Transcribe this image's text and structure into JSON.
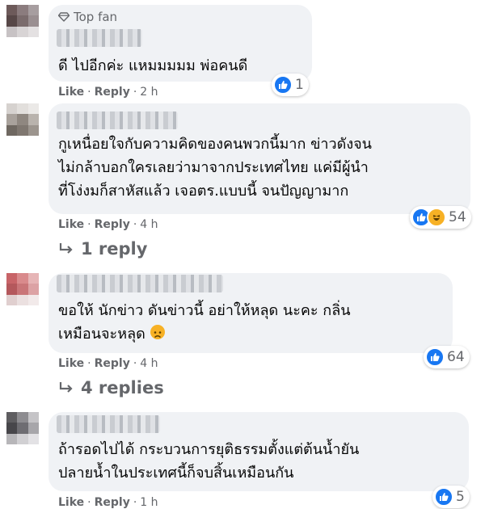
{
  "comments": [
    {
      "badge": "Top fan",
      "text_lines": [
        "ดี ไปอีกค่ะ แหมมมมม พ่อคนดี"
      ],
      "reactions": {
        "types": [
          "like"
        ],
        "count": "1"
      },
      "actions": {
        "like": "Like",
        "reply": "Reply",
        "time": "2 h"
      }
    },
    {
      "text_lines": [
        "กูเหนื่อยใจกับความคิดของคนพวกนี้มาก ข่าวดังจน",
        "ไม่กล้าบอกใครเลยว่ามาจากประเทศไทย แค่มีผู้นำ",
        "ที่โง่งมก็สาหัสแล้ว เจอตร.แบบนี้ จนปัญญามาก"
      ],
      "reactions": {
        "types": [
          "like",
          "haha"
        ],
        "count": "54"
      },
      "actions": {
        "like": "Like",
        "reply": "Reply",
        "time": "4 h"
      },
      "replies_label": "1 reply"
    },
    {
      "text_lines": [
        "ขอให้ นักข่าว ดันข่าวนี้ อย่าให้หลุด นะคะ กลิ่น",
        "เหมือนจะหลุด"
      ],
      "reactions": {
        "types": [
          "like"
        ],
        "count": "64"
      },
      "actions": {
        "like": "Like",
        "reply": "Reply",
        "time": "4 h"
      },
      "replies_label": "4 replies"
    },
    {
      "text_lines": [
        "ถ้ารอดไปได้ กระบวนการยุติธรรมตั้งแต่ต้นน้ำยัน",
        "ปลายน้ำในประเทศนี้ก็จบสิ้นเหมือนกัน"
      ],
      "reactions": {
        "types": [
          "like"
        ],
        "count": "5"
      },
      "actions": {
        "like": "Like",
        "reply": "Reply",
        "time": "1 h"
      }
    }
  ],
  "dot": "·",
  "colors": {
    "bubble": "#f0f2f5",
    "like_blue": "#1877f2",
    "meta_gray": "#65676b",
    "haha_yellow": "#f7b125"
  }
}
